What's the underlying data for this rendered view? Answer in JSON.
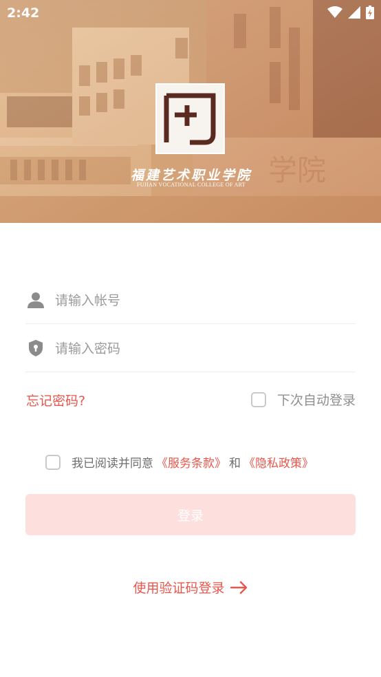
{
  "status_bar": {
    "time": "2:42",
    "icons": [
      "wifi-icon",
      "signal-icon",
      "battery-icon"
    ]
  },
  "header": {
    "college_name_cn": "福建艺术职业学院",
    "college_name_en": "FUJIAN VOCATIONAL COLLEGE OF ART",
    "logo_letters": "FJ"
  },
  "form": {
    "account_placeholder": "请输入帐号",
    "password_placeholder": "请输入密码",
    "forgot_password": "忘记密码?",
    "auto_login": "下次自动登录",
    "auto_login_checked": false
  },
  "agreement": {
    "checked": false,
    "prefix": "我已阅读并同意",
    "terms": "《服务条款》",
    "conjunction": "和",
    "privacy": "《隐私政策》"
  },
  "login_button": "登录",
  "code_login": "使用验证码登录",
  "colors": {
    "accent": "#e8574c",
    "button_disabled_bg": "#fde0dd",
    "placeholder": "#9b9b9b",
    "divider": "#ededed"
  }
}
